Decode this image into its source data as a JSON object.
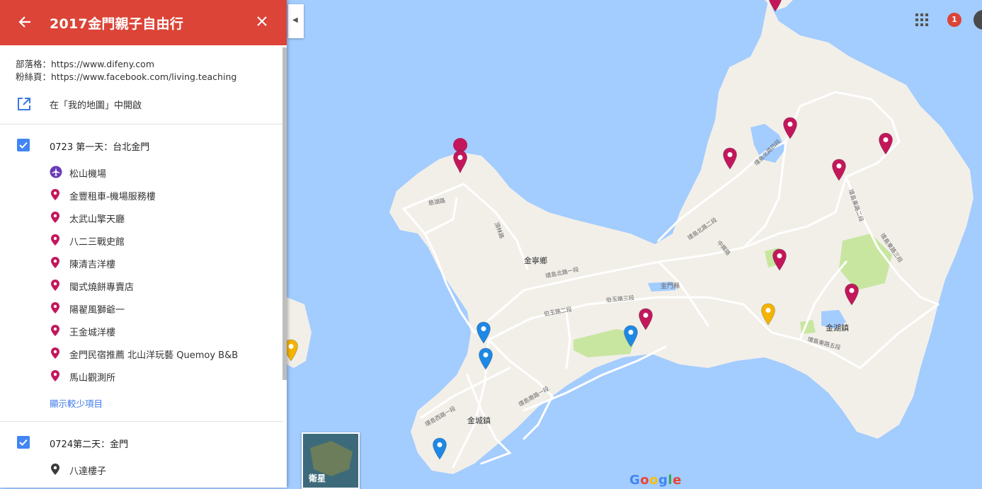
{
  "header": {
    "title": "2017金門親子自由行"
  },
  "description": {
    "line1": "部落格：https://www.difeny.com",
    "line2": "粉絲頁：https://www.facebook.com/living.teaching"
  },
  "open_in_my_maps": "在「我的地圖」中開啟",
  "layers": [
    {
      "name": "0723 第一天：台北金門",
      "checked": true,
      "items": [
        {
          "label": "松山機場",
          "icon": "airplane-icon",
          "color": "#673ab7"
        },
        {
          "label": "金豐租車-機場服務樓",
          "icon": "map-pin-icon",
          "color": "#c2185b"
        },
        {
          "label": "太武山擎天廳",
          "icon": "map-pin-icon",
          "color": "#c2185b"
        },
        {
          "label": "八二三戰史館",
          "icon": "map-pin-icon",
          "color": "#c2185b"
        },
        {
          "label": "陳清吉洋樓",
          "icon": "map-pin-icon",
          "color": "#c2185b"
        },
        {
          "label": "閩式燒餅專賣店",
          "icon": "map-pin-icon",
          "color": "#c2185b"
        },
        {
          "label": "陽翟風獅爺一",
          "icon": "map-pin-icon",
          "color": "#c2185b"
        },
        {
          "label": "王金城洋樓",
          "icon": "map-pin-icon",
          "color": "#c2185b"
        },
        {
          "label": "金門民宿推薦 北山洋玩藝 Quemoy B&B",
          "icon": "map-pin-icon",
          "color": "#c2185b"
        },
        {
          "label": "馬山觀測所",
          "icon": "map-pin-icon",
          "color": "#c2185b"
        }
      ],
      "show_less": "顯示較少項目"
    },
    {
      "name": "0724第二天：金門",
      "checked": true,
      "items": [
        {
          "label": "八達樓子",
          "icon": "map-pin-icon",
          "color": "#3c3c3c"
        }
      ]
    }
  ],
  "map": {
    "labels": {
      "jinning": "金寧鄉",
      "jinhu": "金湖鎮",
      "jincheng": "金城鎮",
      "jinmen_county": "金門縣"
    },
    "road_labels": [
      "環島北路一段",
      "環島北路二段",
      "環島北路三段",
      "環島北路四段",
      "伯玉路二段",
      "伯玉路三段",
      "環島東路一段",
      "環島東路二段",
      "環島東路三段",
      "環島東路四段",
      "環島東路五段",
      "環島南路一段",
      "環島西路一段",
      "慈湖路",
      "頂林路",
      "中興路"
    ],
    "satellite_label": "衛星",
    "google_logo": "Google",
    "notification_count": "1",
    "colors": {
      "water": "#a3ccff",
      "land": "#f2efe9",
      "park": "#c8e6a0",
      "pin_red": "#c2185b",
      "pin_blue": "#1e88e5",
      "pin_yellow": "#f4b400"
    }
  }
}
